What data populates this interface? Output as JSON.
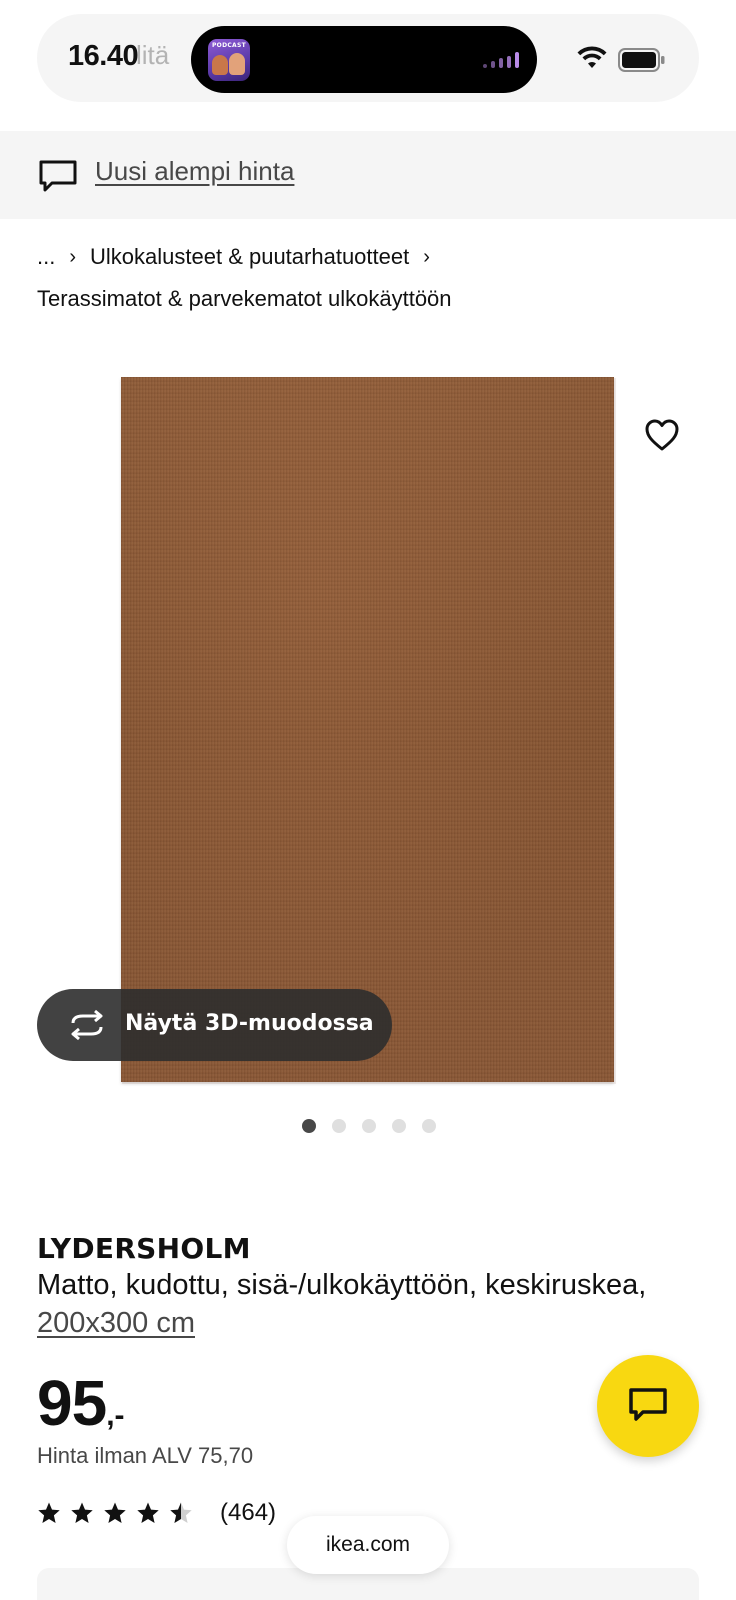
{
  "status_bar": {
    "time": "16.40",
    "search_placeholder": "Hae kaikkea, mitä tarvitset kotiisi",
    "now_playing_icon": "podcast-artwork-icon",
    "icons": [
      "wifi-icon",
      "battery-icon"
    ]
  },
  "notice": {
    "icon": "chat-bubble-icon",
    "text": "Uusi alempi hinta"
  },
  "breadcrumb": {
    "ellipsis": "...",
    "items": [
      "Ulkokalusteet & puutarhatuotteet",
      "Terassimatot & parvekematot ulkokäyttöön"
    ],
    "separator": "›"
  },
  "gallery": {
    "favorite_icon": "heart-icon",
    "view_3d_label": "Näytä 3D-muodossa",
    "view_3d_icon": "rotate-3d-icon",
    "active_image": 1,
    "image_count": 5
  },
  "product": {
    "name": "LYDERSHOLM",
    "description": "Matto, kudottu, sisä-/ulkokäyttöön, keskiruskea,",
    "size": "200x300 cm",
    "price_integer": "95",
    "price_decimal": ",-",
    "price_vat": "Hinta ilman ALV 75,70",
    "rating_value": 4.5,
    "rating_count": "(464)"
  },
  "chat_button": {
    "icon": "chat-icon"
  },
  "browser": {
    "url": "ikea.com"
  },
  "colors": {
    "accent_yellow": "#f8d811",
    "text_dark": "#111111",
    "text_muted": "#484848",
    "rug_brown": "#8a5734"
  }
}
